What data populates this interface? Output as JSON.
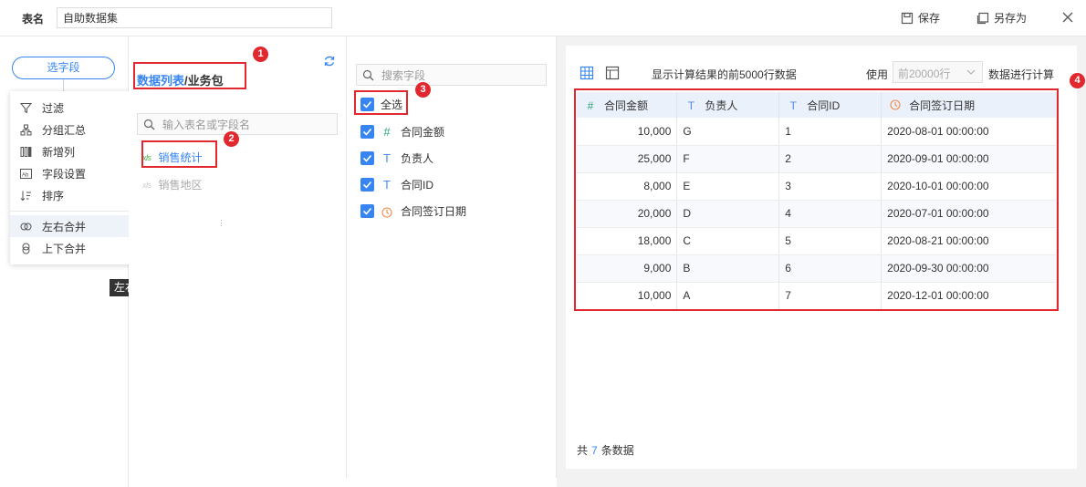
{
  "topbar": {
    "table_name_label": "表名",
    "table_name_value": "自助数据集",
    "save_label": "保存",
    "save_as_label": "另存为"
  },
  "left": {
    "select_field_label": "选字段",
    "plus_label": "+",
    "menu": [
      "过滤",
      "分组汇总",
      "新增列",
      "字段设置",
      "排序",
      "左右合并",
      "上下合并"
    ],
    "tooltip": "左右合并"
  },
  "datalist": {
    "title_part1": "数据列表",
    "title_part2": "/业务包",
    "search_placeholder": "输入表名或字段名",
    "tables": [
      {
        "icon": "xls",
        "name": "销售统计",
        "selected": true
      },
      {
        "icon": "xls",
        "name": "销售地区",
        "selected": false
      }
    ]
  },
  "fields": {
    "search_placeholder": "搜索字段",
    "select_all": "全选",
    "items": [
      {
        "type": "#",
        "name": "合同金额"
      },
      {
        "type": "T",
        "name": "负责人"
      },
      {
        "type": "T",
        "name": "合同ID"
      },
      {
        "type": "clock",
        "name": "合同签订日期"
      }
    ]
  },
  "preview": {
    "desc": "显示计算结果的前5000行数据",
    "use_label": "使用",
    "rows_option": "前20000行",
    "calc_label": "数据进行计算",
    "columns": [
      {
        "icon": "#",
        "name": "合同金额"
      },
      {
        "icon": "T",
        "name": "负责人"
      },
      {
        "icon": "T",
        "name": "合同ID"
      },
      {
        "icon": "clock",
        "name": "合同签订日期"
      }
    ],
    "rows": [
      [
        "10,000",
        "G",
        "1",
        "2020-08-01 00:00:00"
      ],
      [
        "25,000",
        "F",
        "2",
        "2020-09-01 00:00:00"
      ],
      [
        "8,000",
        "E",
        "3",
        "2020-10-01 00:00:00"
      ],
      [
        "20,000",
        "D",
        "4",
        "2020-07-01 00:00:00"
      ],
      [
        "18,000",
        "C",
        "5",
        "2020-08-21 00:00:00"
      ],
      [
        "9,000",
        "B",
        "6",
        "2020-09-30 00:00:00"
      ],
      [
        "10,000",
        "A",
        "7",
        "2020-12-01 00:00:00"
      ]
    ],
    "total_prefix": "共",
    "total_count": "7",
    "total_suffix": "条数据"
  },
  "annotations": [
    "1",
    "2",
    "3",
    "4"
  ],
  "colors": {
    "accent": "#3685f2",
    "annotation": "#e0282e",
    "number_icon": "#2ba37c",
    "date_icon": "#f08a4b"
  }
}
